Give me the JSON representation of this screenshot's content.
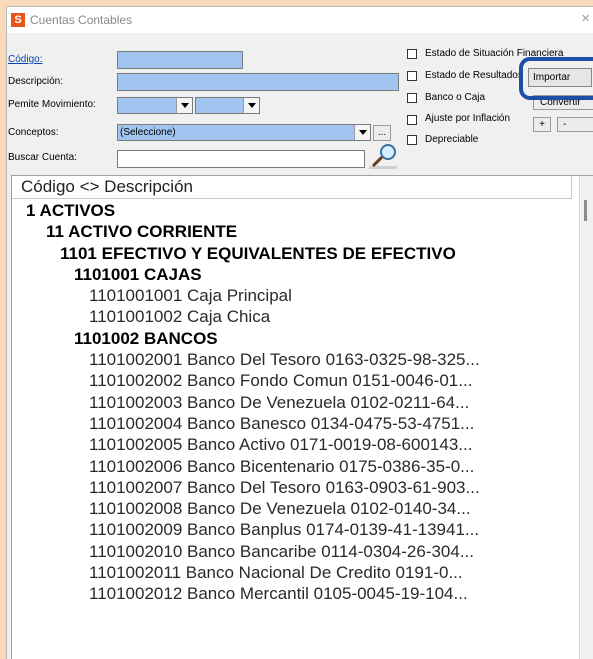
{
  "window": {
    "title": "Cuentas Contables",
    "icon_letter": "S"
  },
  "form": {
    "codigo_label": "Código:",
    "descripcion_label": "Descripción:",
    "movimiento_label": "Pemite Movimiento:",
    "conceptos_label": "Conceptos:",
    "conceptos_value": "(Seleccione)",
    "conceptos_more": "...",
    "buscar_label": "Buscar Cuenta:"
  },
  "checkboxes": {
    "situacion": "Estado de Situación Financiera",
    "resultados": "Estado de Resultados",
    "banco": "Banco o Caja",
    "ajuste": "Ajuste por Inflación",
    "depreciable": "Depreciable"
  },
  "buttons": {
    "importar": "Importar",
    "convertir": "Convertir",
    "plus": "+",
    "minus": "-"
  },
  "tree": {
    "header": "Código <> Descripción",
    "rows": [
      {
        "text": "1 ACTIVOS",
        "indent": 1,
        "bold": true
      },
      {
        "text": "11 ACTIVO CORRIENTE",
        "indent": 2,
        "bold": true
      },
      {
        "text": "1101 EFECTIVO Y EQUIVALENTES DE EFECTIVO",
        "indent": 3,
        "bold": true
      },
      {
        "text": "1101001 CAJAS",
        "indent": 4,
        "bold": true
      },
      {
        "text": "1101001001 Caja Principal",
        "indent": 5,
        "bold": false
      },
      {
        "text": "1101001002 Caja Chica",
        "indent": 5,
        "bold": false
      },
      {
        "text": "1101002 BANCOS",
        "indent": 4,
        "bold": true
      },
      {
        "text": "1101002001 Banco Del Tesoro 0163-0325-98-325...",
        "indent": 5,
        "bold": false
      },
      {
        "text": "1101002002 Banco Fondo Comun 0151-0046-01...",
        "indent": 5,
        "bold": false
      },
      {
        "text": "1101002003 Banco De Venezuela 0102-0211-64...",
        "indent": 5,
        "bold": false
      },
      {
        "text": "1101002004 Banco Banesco 0134-0475-53-4751...",
        "indent": 5,
        "bold": false
      },
      {
        "text": "1101002005 Banco Activo 0171-0019-08-600143...",
        "indent": 5,
        "bold": false
      },
      {
        "text": "1101002006 Banco Bicentenario 0175-0386-35-0...",
        "indent": 5,
        "bold": false
      },
      {
        "text": "1101002007 Banco Del Tesoro 0163-0903-61-903...",
        "indent": 5,
        "bold": false
      },
      {
        "text": "1101002008 Banco De Venezuela 0102-0140-34...",
        "indent": 5,
        "bold": false
      },
      {
        "text": "1101002009 Banco Banplus 0174-0139-41-13941...",
        "indent": 5,
        "bold": false
      },
      {
        "text": "1101002010 Banco Bancaribe 0114-0304-26-304...",
        "indent": 5,
        "bold": false
      },
      {
        "text": "1101002011 Banco Nacional De Credito 0191-0...",
        "indent": 5,
        "bold": false
      },
      {
        "text": "1101002012 Banco Mercantil 0105-0045-19-104...",
        "indent": 5,
        "bold": false
      }
    ]
  }
}
